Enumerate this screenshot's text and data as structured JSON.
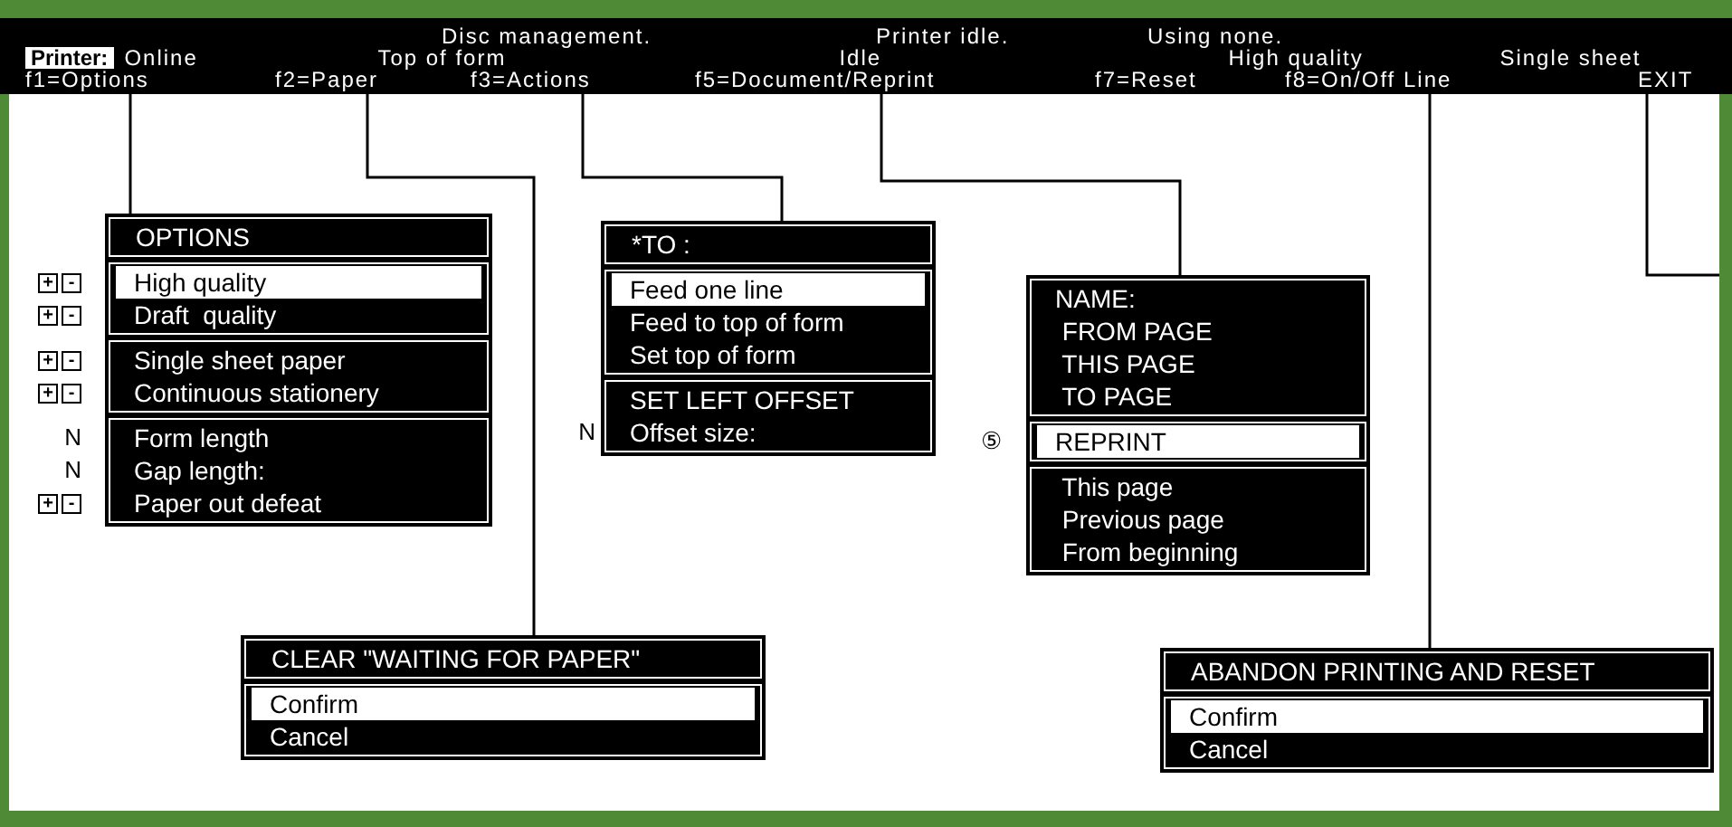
{
  "status_bar": {
    "top_line": [
      "Disc management.",
      "Printer idle.",
      "Using none."
    ],
    "printer_label": "Printer:",
    "status_line": [
      "Online",
      "Top of form",
      "Idle",
      "High quality",
      "Single sheet"
    ],
    "keys": [
      "f1=Options",
      "f2=Paper",
      "f3=Actions",
      "f5=Document/Reprint",
      "f7=Reset",
      "f8=On/Off Line",
      "EXIT"
    ]
  },
  "menus": [
    {
      "title": "OPTIONS",
      "groups": [
        [
          {
            "label": "High quality",
            "selected": true,
            "side": {
              "kind": "stepper",
              "plus": "+",
              "minus": "-"
            }
          },
          {
            "label": "Draft  quality",
            "selected": false,
            "side": {
              "kind": "stepper",
              "plus": "+",
              "minus": "-"
            }
          }
        ],
        [
          {
            "label": "Single sheet paper",
            "selected": false,
            "side": {
              "kind": "stepper",
              "plus": "+",
              "minus": "-"
            }
          },
          {
            "label": "Continuous stationery",
            "selected": false,
            "side": {
              "kind": "stepper",
              "plus": "+",
              "minus": "-"
            }
          }
        ],
        [
          {
            "label": "Form length",
            "selected": false,
            "side": {
              "kind": "text",
              "text": "N"
            }
          },
          {
            "label": "Gap length:",
            "selected": false,
            "side": {
              "kind": "text",
              "text": "N"
            }
          },
          {
            "label": "Paper out defeat",
            "selected": false,
            "side": {
              "kind": "stepper",
              "plus": "+",
              "minus": "-"
            }
          }
        ]
      ]
    },
    {
      "title": "*TO :",
      "groups": [
        [
          {
            "label": "Feed one line",
            "selected": true
          },
          {
            "label": "Feed to top of form",
            "selected": false
          },
          {
            "label": "Set top of form",
            "selected": false
          }
        ],
        [
          {
            "label": "SET LEFT OFFSET",
            "selected": false
          },
          {
            "label": "Offset size:",
            "selected": false,
            "side": {
              "kind": "text",
              "text": "N"
            }
          }
        ]
      ]
    },
    {
      "groups": [
        [
          {
            "label": "NAME:",
            "selected": false
          },
          {
            "label": " FROM PAGE",
            "selected": false
          },
          {
            "label": " THIS PAGE",
            "selected": false
          },
          {
            "label": " TO PAGE",
            "selected": false
          }
        ],
        [
          {
            "label": "REPRINT",
            "selected": true,
            "side": {
              "kind": "text",
              "text": "⑤"
            }
          }
        ],
        [
          {
            "label": " This page",
            "selected": false
          },
          {
            "label": " Previous page",
            "selected": false
          },
          {
            "label": " From beginning",
            "selected": false
          }
        ]
      ]
    },
    {
      "title": "CLEAR \"WAITING FOR PAPER\"",
      "groups": [
        [
          {
            "label": "Confirm",
            "selected": true
          },
          {
            "label": "Cancel",
            "selected": false
          }
        ]
      ]
    },
    {
      "title": "ABANDON PRINTING AND RESET",
      "groups": [
        [
          {
            "label": "Confirm",
            "selected": true
          },
          {
            "label": "Cancel",
            "selected": false
          }
        ]
      ]
    }
  ]
}
